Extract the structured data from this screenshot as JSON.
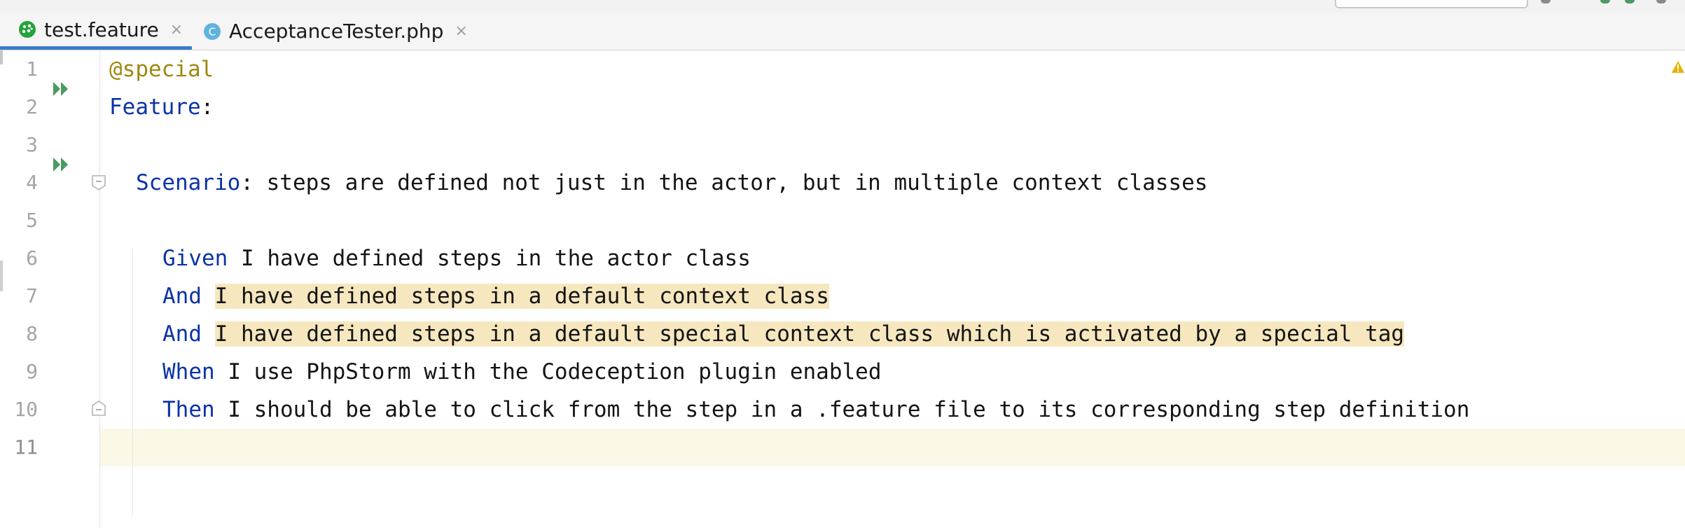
{
  "tabs": [
    {
      "label": "test.feature",
      "icon": "cucumber-feature-icon",
      "active": true
    },
    {
      "label": "AcceptanceTester.php",
      "icon": "php-class-icon",
      "icon_letter": "C",
      "active": false
    }
  ],
  "tab_close_glyph": "×",
  "editor": {
    "line_numbers": [
      "1",
      "2",
      "3",
      "4",
      "5",
      "6",
      "7",
      "8",
      "9",
      "10",
      "11"
    ],
    "lines": {
      "l1": {
        "tag": "@special"
      },
      "l2": {
        "keyword": "Feature",
        "rest": ":"
      },
      "l4": {
        "keyword": "Scenario",
        "rest": ": steps are defined not just in the actor, but in multiple context classes"
      },
      "l6": {
        "keyword": "Given",
        "rest": " I have defined steps in the actor class"
      },
      "l7": {
        "keyword": "And",
        "sep": " ",
        "highlighted": "I have defined steps in a default context class"
      },
      "l8": {
        "keyword": "And",
        "sep": " ",
        "highlighted": "I have defined steps in a default special context class which is activated by a special tag"
      },
      "l9": {
        "keyword": "When",
        "rest": " I use PhpStorm with the Codeception plugin enabled"
      },
      "l10": {
        "keyword": "Then",
        "rest": " I should be able to click from the step in a .feature file to its corresponding step definition"
      }
    }
  },
  "colors": {
    "keyword": "#0b33a8",
    "tag": "#9e880d",
    "step_highlight": "#f6e7bf",
    "run_icon": "#4c9a63",
    "active_tab_underline": "#3d7cc9",
    "current_line": "#fcf8e7",
    "warning": "#e8b200"
  },
  "icons": {
    "run": "run-gutter-icon",
    "fold": "fold-icon",
    "warning": "warning-icon"
  }
}
